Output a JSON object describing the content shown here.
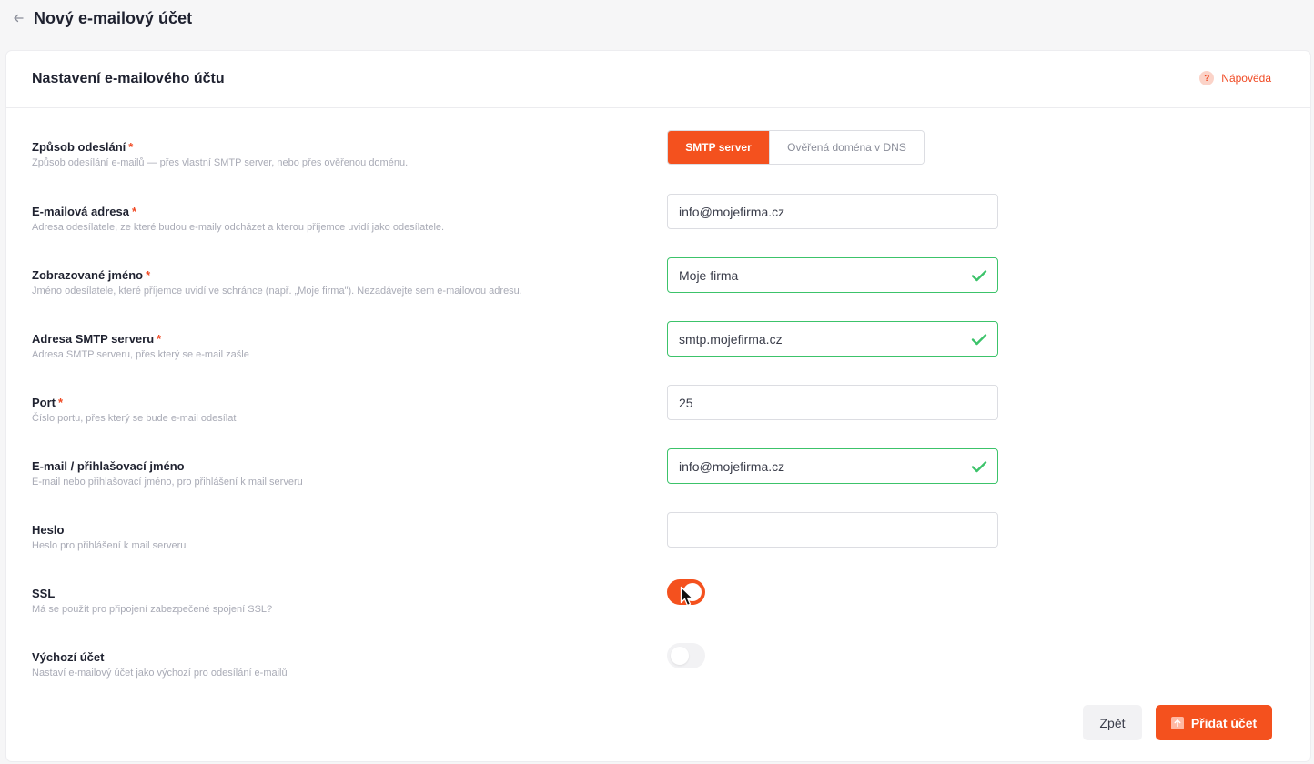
{
  "header": {
    "title": "Nový e-mailový účet"
  },
  "card": {
    "title": "Nastavení e-mailového účtu",
    "help_label": "Nápověda"
  },
  "fields": {
    "send_method": {
      "label": "Způsob odeslání",
      "required": "*",
      "desc": "Způsob odesílání e-mailů — přes vlastní SMTP server, nebo přes ověřenou doménu.",
      "options": [
        "SMTP server",
        "Ověřená doména v DNS"
      ],
      "selected": "SMTP server"
    },
    "email": {
      "label": "E-mailová adresa",
      "required": "*",
      "desc": "Adresa odesílatele, ze které budou e-maily odcházet a kterou příjemce uvidí jako odesílatele.",
      "value": "info@mojefirma.cz"
    },
    "display_name": {
      "label": "Zobrazované jméno",
      "required": "*",
      "desc": "Jméno odesílatele, které příjemce uvidí ve schránce (např. „Moje firma\"). Nezadávejte sem e-mailovou adresu.",
      "value": "Moje firma"
    },
    "smtp_host": {
      "label": "Adresa SMTP serveru",
      "required": "*",
      "desc": "Adresa SMTP serveru, přes který se e-mail zašle",
      "value": "smtp.mojefirma.cz"
    },
    "port": {
      "label": "Port",
      "required": "*",
      "desc": "Číslo portu, přes který se bude e-mail odesílat",
      "value": "25"
    },
    "login": {
      "label": "E-mail / přihlašovací jméno",
      "desc": "E-mail nebo přihlašovací jméno, pro přihlášení k mail serveru",
      "value": "info@mojefirma.cz"
    },
    "password": {
      "label": "Heslo",
      "desc": "Heslo pro přihlášení k mail serveru",
      "value": ""
    },
    "ssl": {
      "label": "SSL",
      "desc": "Má se použít pro připojení zabezpečené spojení SSL?",
      "on": true
    },
    "default_account": {
      "label": "Výchozí účet",
      "desc": "Nastaví e-mailový účet jako výchozí pro odesílání e-mailů",
      "on": false
    }
  },
  "actions": {
    "back_label": "Zpět",
    "add_label": "Přidat účet"
  },
  "colors": {
    "accent": "#f4511e",
    "valid": "#3cc36a",
    "required": "#f04a24"
  },
  "icons": [
    "back-arrow-icon",
    "help-icon",
    "check-icon",
    "cursor-icon",
    "upload-icon"
  ]
}
